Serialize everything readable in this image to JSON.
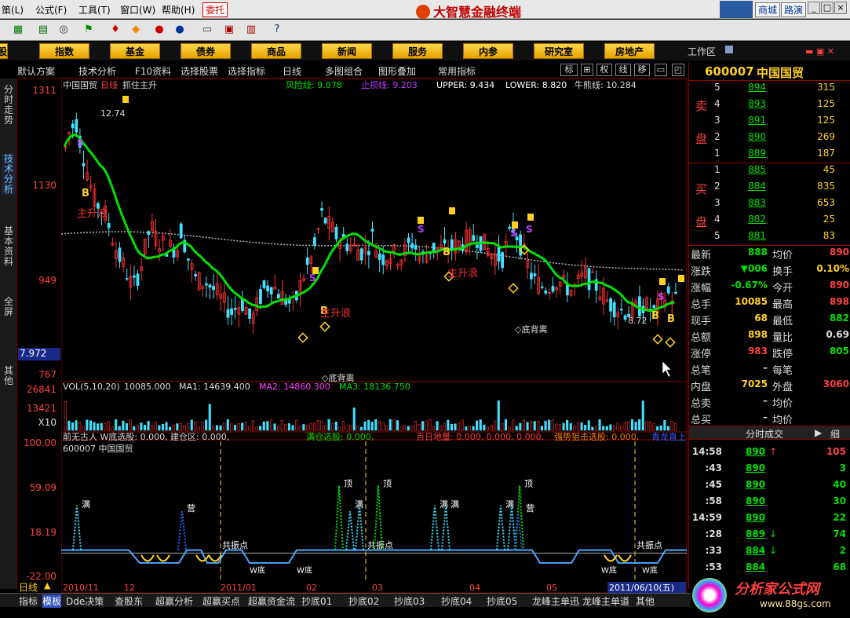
{
  "menu": [
    "策(L)",
    "公式(F)",
    "工具(T)",
    "窗口(W)",
    "帮助(H)"
  ],
  "weituo": "委托",
  "app_title": "大智慧金融终端",
  "top_buttons": [
    "商城",
    "路演"
  ],
  "categories": [
    "股",
    "指数",
    "基金",
    "债券",
    "商品",
    "新闻",
    "服务",
    "内参",
    "研究室",
    "房地产"
  ],
  "workzone": "工作区",
  "chart_toolbar": [
    "默认方案",
    "技术分析",
    "F10资料",
    "选择股票",
    "选择指标",
    "日线",
    "多图组合",
    "图形叠加",
    "常用指标"
  ],
  "chart_toolbar_right": [
    "标",
    "⊞",
    "权",
    "线",
    "移"
  ],
  "left_tabs": [
    "分时走势",
    "技术分析",
    "基本资料",
    "全屏",
    "其他"
  ],
  "price_axis": [
    "1311",
    "1130",
    "949",
    "767"
  ],
  "price_axis_lowlabel": "7.972",
  "vol_axis": [
    "26841",
    "13421",
    "X10"
  ],
  "ind_axis": [
    "100.00",
    "59.09",
    "18.19",
    "-22.00"
  ],
  "main_header": {
    "stock": "中国国贸",
    "period": "日线",
    "formula": "抓住主升",
    "risk_line": "风险线: 9.078",
    "stop_line": "止损线: 9.203",
    "upper": "UPPER: 9.434",
    "lower": "LOWER: 8.820",
    "bull_line": "牛熊线: 10.284"
  },
  "vol_header": {
    "label": "VOL(5,10,20)",
    "vol": "10085.000",
    "ma1": "MA1: 14639.400",
    "ma2": "MA2: 14860.300",
    "ma3": "MA3: 18136.750"
  },
  "ind_header": {
    "line1": "前无古人  W底选股: 0.000, 建仓区: 0.000,",
    "line1b": "满仓选股: 0.000,",
    "line1c": "百日地量: 0.000, 0.000, 0.000,",
    "line1d": "强势狙击选股: 0.000,",
    "line1e": "青龙直上",
    "line2": "600007 中国国贸"
  },
  "annotations": {
    "hi": "12.74",
    "lo": "8.72",
    "rise": "主升浪",
    "divergence": "◇底背离",
    "divergence2": "◇底背离",
    "gongzhen": "共振点",
    "man": "满",
    "ding": "顶",
    "mai": "营",
    "wdi": "W底"
  },
  "date_axis": [
    "2010/11",
    "12",
    "2011/01",
    "02",
    "03",
    "04",
    "05",
    "2011/06/10(五)"
  ],
  "bottom_tabs": [
    "指标",
    "模板",
    "Dde决策",
    "查股东",
    "超赢分析",
    "超赢买点",
    "超赢资金流",
    "抄底01",
    "抄底02",
    "抄底03",
    "抄底04",
    "抄底05",
    "龙峰主单迅",
    "龙峰主单道",
    "其他"
  ],
  "period_tab": "日线",
  "quote": {
    "code": "600007",
    "name": "中国国贸",
    "sell_label": [
      "卖",
      "盘"
    ],
    "buy_label": [
      "买",
      "盘"
    ],
    "sells": [
      [
        "5",
        "894",
        "315"
      ],
      [
        "4",
        "893",
        "125"
      ],
      [
        "3",
        "891",
        "125"
      ],
      [
        "2",
        "890",
        "269"
      ],
      [
        "1",
        "889",
        "187"
      ]
    ],
    "buys": [
      [
        "1",
        "885",
        "45"
      ],
      [
        "2",
        "884",
        "835"
      ],
      [
        "3",
        "883",
        "653"
      ],
      [
        "4",
        "882",
        "25"
      ],
      [
        "5",
        "881",
        "83"
      ]
    ],
    "stats": [
      [
        "最新",
        "888",
        "均价",
        "890"
      ],
      [
        "涨跌",
        "▼006",
        "换手",
        "0.10%"
      ],
      [
        "涨幅",
        "-0.67%",
        "今开",
        "890"
      ],
      [
        "总手",
        "10085",
        "最高",
        "898"
      ],
      [
        "现手",
        "68",
        "最低",
        "882"
      ],
      [
        "总额",
        "898",
        "量比",
        "0.69"
      ],
      [
        "涨停",
        "983",
        "跌停",
        "805"
      ],
      [
        "总笔",
        "–",
        "每笔",
        ""
      ],
      [
        "内盘",
        "7025",
        "外盘",
        "3060"
      ],
      [
        "总卖",
        "–",
        "均价",
        ""
      ],
      [
        "总买",
        "–",
        "均价",
        ""
      ]
    ],
    "ticks_title": "分时成交",
    "ticks_more": "细",
    "ticks": [
      [
        "14:58",
        "890",
        "↑",
        "105"
      ],
      [
        ":43",
        "890",
        "",
        "3"
      ],
      [
        ":45",
        "890",
        "",
        "40"
      ],
      [
        ":58",
        "890",
        "",
        "30"
      ],
      [
        "14:59",
        "890",
        "",
        "22"
      ],
      [
        ":28",
        "889",
        "↓",
        "74"
      ],
      [
        ":33",
        "884",
        "↓",
        "2"
      ],
      [
        ":53",
        "884",
        "",
        "68"
      ]
    ]
  },
  "watermark": {
    "title": "分析家公式网",
    "url": "www.88gs.com"
  },
  "colors": {
    "up": "#ff3030",
    "down": "#40e0ff",
    "ma": "#00e000",
    "gold": "#ffd020",
    "axis": "#ff4040",
    "purple": "#c040ff"
  }
}
